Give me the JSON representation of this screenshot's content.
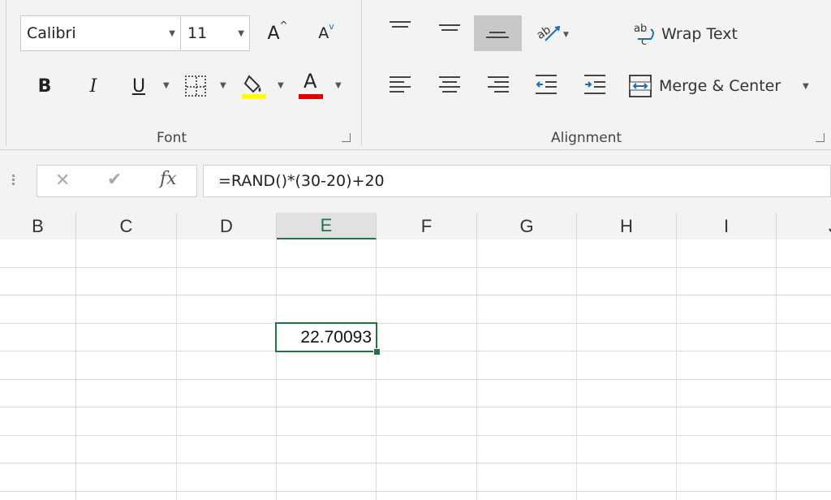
{
  "ribbon": {
    "font_group": {
      "font_name": "Calibri",
      "font_size": "11",
      "increase_font_glyph": "A",
      "decrease_font_glyph": "A",
      "bold": "B",
      "italic": "I",
      "underline": "U",
      "font_color_glyph": "A",
      "label": "Font",
      "highlight_color": "#ffff00",
      "font_color": "#e00000"
    },
    "alignment_group": {
      "wrap_text": "Wrap Text",
      "merge_center": "Merge & Center",
      "label": "Alignment"
    }
  },
  "formula_bar": {
    "fx": "fx",
    "formula": "=RAND()*(30-20)+20"
  },
  "grid": {
    "columns": [
      "B",
      "C",
      "D",
      "E",
      "F",
      "G",
      "H",
      "I",
      "J"
    ],
    "selected_column": "E",
    "active_cell_value": "22.70093",
    "accent_color": "#217346"
  }
}
